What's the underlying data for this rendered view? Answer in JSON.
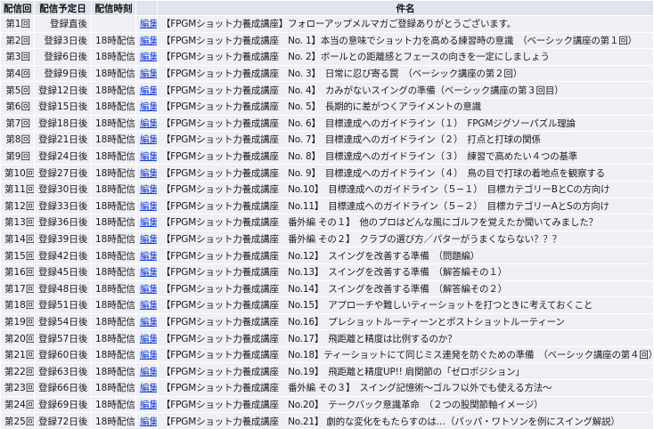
{
  "headers": {
    "num": "配信回",
    "day": "配信予定日",
    "time": "配信時刻",
    "edit": "",
    "subject": "件名"
  },
  "edit_label": "編集",
  "rows": [
    {
      "num": "第1回",
      "day": "登録直後",
      "time": "",
      "subject": "【FPGMショット力養成講座】フォローアップメルマガご登録ありがとうございます。"
    },
    {
      "num": "第2回",
      "day": "登録3日後",
      "time": "18時配信",
      "subject": "【FPGMショット力養成講座　No. 1】本当の意味でショット力を高める練習時の意識　（ベーシック講座の第１回）"
    },
    {
      "num": "第3回",
      "day": "登録6日後",
      "time": "18時配信",
      "subject": "【FPGMショット力養成講座　No. 2】ボールとの距離感とフェースの向きを一定にしましょう"
    },
    {
      "num": "第4回",
      "day": "登録9日後",
      "time": "18時配信",
      "subject": "【FPGMショット力養成講座　No. 3】　日常に忍び寄る罠　（ベーシック講座の第２回）"
    },
    {
      "num": "第5回",
      "day": "登録12日後",
      "time": "18時配信",
      "subject": "【FPGMショット力養成講座　No. 4】　カみがないスイングの準備（ベーシック講座の第３回目）"
    },
    {
      "num": "第6回",
      "day": "登録15日後",
      "time": "18時配信",
      "subject": "【FPGMショット力養成講座　No. 5】　長期的に差がつくアライメントの意識"
    },
    {
      "num": "第7回",
      "day": "登録18日後",
      "time": "18時配信",
      "subject": "【FPGMショット力養成講座　No. 6】　目標達成へのガイドライン（１）　FPGMジグソーパズル理論"
    },
    {
      "num": "第8回",
      "day": "登録21日後",
      "time": "18時配信",
      "subject": "【FPGMショット力養成講座　No. 7】　目標達成へのガイドライン（２）　打点と打球の関係"
    },
    {
      "num": "第9回",
      "day": "登録24日後",
      "time": "18時配信",
      "subject": "【FPGMショット力養成講座　No. 8】　目標達成へのガイドライン（３）　練習で高めたい４つの基準"
    },
    {
      "num": "第10回",
      "day": "登録27日後",
      "time": "18時配信",
      "subject": "【FPGMショット力養成講座　No. 9】　目標達成へのガイドライン（４）　鳥の目で打球の着地点を観察する"
    },
    {
      "num": "第11回",
      "day": "登録30日後",
      "time": "18時配信",
      "subject": "【FPGMショット力養成講座　No.10】　目標達成へのガイドライン（５−１）　目標カテゴリーBとCの方向け"
    },
    {
      "num": "第12回",
      "day": "登録33日後",
      "time": "18時配信",
      "subject": "【FPGMショット力養成講座　No.11】　目標達成へのガイドライン（５−２）　目標カテゴリーAとSの方向け"
    },
    {
      "num": "第13回",
      "day": "登録36日後",
      "time": "18時配信",
      "subject": "【FPGMショット力養成講座　番外編 その１】　他のプロはどんな風にゴルフを覚えたか聞いてみました？"
    },
    {
      "num": "第14回",
      "day": "登録39日後",
      "time": "18時配信",
      "subject": "【FPGMショット力養成講座　番外編 その２】　クラブの選び方／パターがうまくならない？？？"
    },
    {
      "num": "第15回",
      "day": "登録42日後",
      "time": "18時配信",
      "subject": "【FPGMショット力養成講座　No.12】　スイングを改善する準備　（問題編）"
    },
    {
      "num": "第16回",
      "day": "登録45日後",
      "time": "18時配信",
      "subject": "【FPGMショット力養成講座　No.13】　スイングを改善する準備　（解答編その１）"
    },
    {
      "num": "第17回",
      "day": "登録48日後",
      "time": "18時配信",
      "subject": "【FPGMショット力養成講座　No.14】　スイングを改善する準備　（解答編その２）"
    },
    {
      "num": "第18回",
      "day": "登録51日後",
      "time": "18時配信",
      "subject": "【FPGMショット力養成講座　No.15】　アプローチや難しいティーショットを打つときに考えておくこと"
    },
    {
      "num": "第19回",
      "day": "登録54日後",
      "time": "18時配信",
      "subject": "【FPGMショット力養成講座　No.16】　プレショットルーティーンとポストショットルーティーン"
    },
    {
      "num": "第20回",
      "day": "登録57日後",
      "time": "18時配信",
      "subject": "【FPGMショット力養成講座　No.17】　飛距離と精度は比例するのか？"
    },
    {
      "num": "第21回",
      "day": "登録60日後",
      "time": "18時配信",
      "subject": "【FPGMショット力養成講座　No.18】ティーショットにて同じミス連発を防ぐための準備　（ベーシック講座の第４回）"
    },
    {
      "num": "第22回",
      "day": "登録63日後",
      "time": "18時配信",
      "subject": "【FPGMショット力養成講座　No.19】　飛距離と精度UP!! 肩関節の「ゼロポジション」"
    },
    {
      "num": "第23回",
      "day": "登録66日後",
      "time": "18時配信",
      "subject": "【FPGMショット力養成講座　番外編 その３】　スイング記憶術〜ゴルフ以外でも使える方法〜"
    },
    {
      "num": "第24回",
      "day": "登録69日後",
      "time": "18時配信",
      "subject": "【FPGMショット力養成講座　No.20】　テークバック意識革命　（２つの股関節軸イメージ）"
    },
    {
      "num": "第25回",
      "day": "登録72日後",
      "time": "18時配信",
      "subject": "【FPGMショット力養成講座　No.21】 劇的な変化をもたらすのは…（パッパ・ワトソンを例にスイング解説）"
    }
  ],
  "colors": {
    "header_bg": "#dfe4ee",
    "cell_bg": "#eef0f5",
    "link": "#1a3fd1"
  }
}
